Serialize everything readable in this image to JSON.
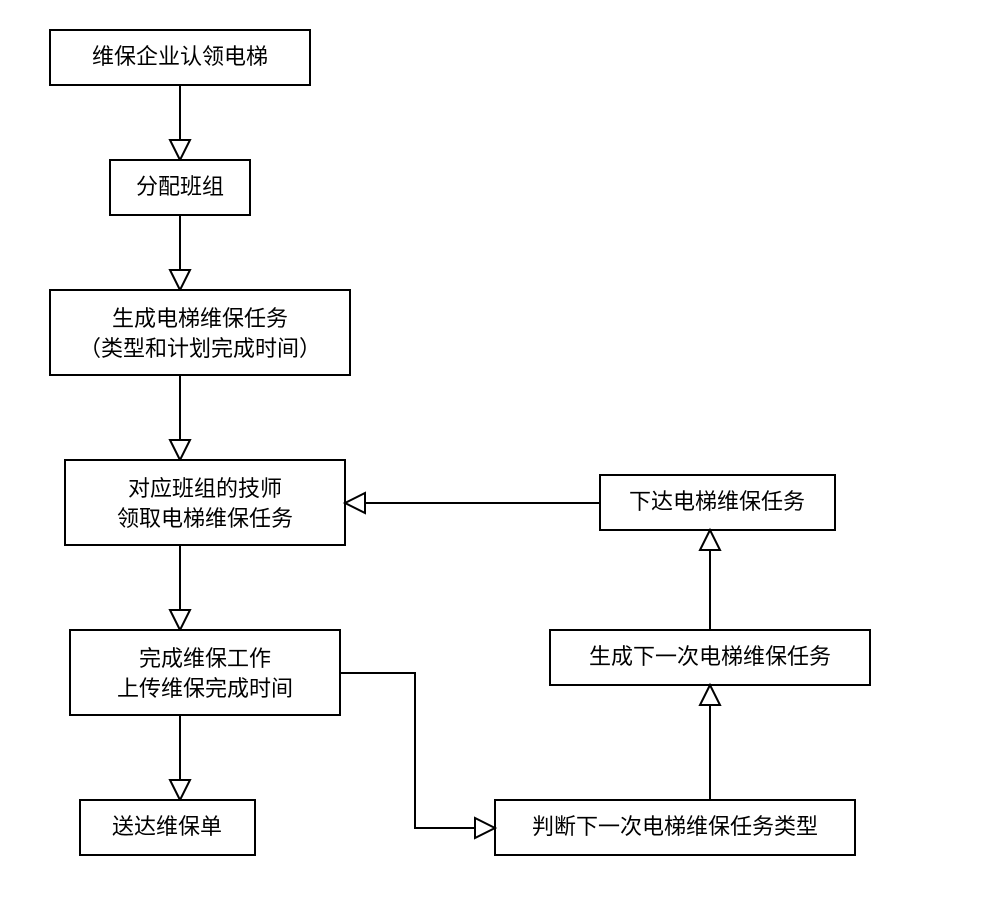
{
  "diagram": {
    "boxes": {
      "b1": {
        "line1": "维保企业认领电梯"
      },
      "b2": {
        "line1": "分配班组"
      },
      "b3": {
        "line1": "生成电梯维保任务",
        "line2": "（类型和计划完成时间）"
      },
      "b4": {
        "line1": "对应班组的技师",
        "line2": "领取电梯维保任务"
      },
      "b5": {
        "line1": "完成维保工作",
        "line2": "上传维保完成时间"
      },
      "b6": {
        "line1": "送达维保单"
      },
      "b7": {
        "line1": "判断下一次电梯维保任务类型"
      },
      "b8": {
        "line1": "生成下一次电梯维保任务"
      },
      "b9": {
        "line1": "下达电梯维保任务"
      }
    }
  }
}
